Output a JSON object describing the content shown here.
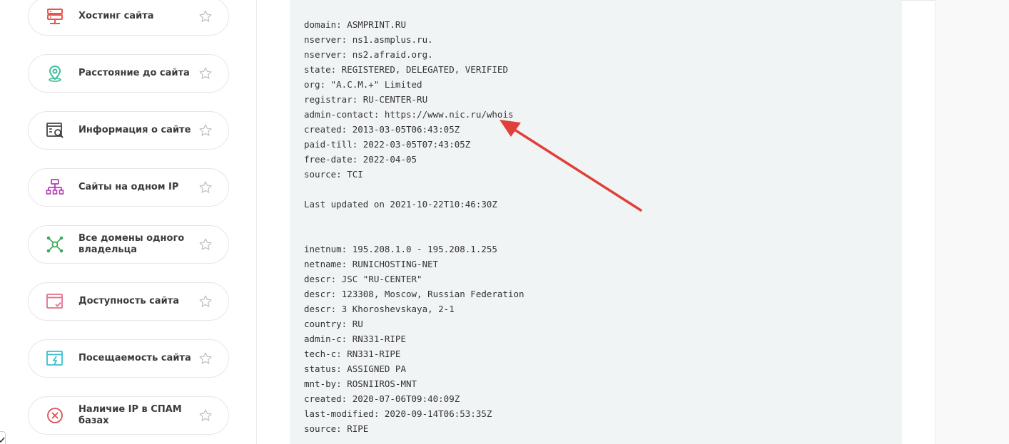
{
  "sidebar": {
    "items": [
      {
        "label": "Хостинг сайта",
        "icon": "server-icon",
        "color": "#e8554e"
      },
      {
        "label": "Расстояние до сайта",
        "icon": "map-pin-icon",
        "color": "#3bbf9c"
      },
      {
        "label": "Информация о сайте",
        "icon": "site-search-icon",
        "color": "#444444"
      },
      {
        "label": "Сайты на одном IP",
        "icon": "network-icon",
        "color": "#b53fb6"
      },
      {
        "label": "Все домены одного владельца",
        "icon": "hub-icon",
        "color": "#3daa5a"
      },
      {
        "label": "Доступность сайта",
        "icon": "window-check-icon",
        "color": "#e86d8c"
      },
      {
        "label": "Посещаемость сайта",
        "icon": "window-bolt-icon",
        "color": "#3cbfcf"
      },
      {
        "label": "Наличие IP в СПАМ базах",
        "icon": "block-icon",
        "color": "#e04f4f"
      }
    ]
  },
  "whois": {
    "lines": [
      "domain: ASMPRINT.RU",
      "nserver: ns1.asmplus.ru.",
      "nserver: ns2.afraid.org.",
      "state: REGISTERED, DELEGATED, VERIFIED",
      "org: \"A.C.M.+\" Limited",
      "registrar: RU-CENTER-RU",
      "admin-contact: https://www.nic.ru/whois",
      "created: 2013-03-05T06:43:05Z",
      "paid-till: 2022-03-05T07:43:05Z",
      "free-date: 2022-04-05",
      "source: TCI",
      "",
      "Last updated on 2021-10-22T10:46:30Z",
      "",
      "",
      "inetnum: 195.208.1.0 - 195.208.1.255",
      "netname: RUNICHOSTING-NET",
      "descr: JSC \"RU-CENTER\"",
      "descr: 123308, Moscow, Russian Federation",
      "descr: 3 Khoroshevskaya, 2-1",
      "country: RU",
      "admin-c: RN331-RIPE",
      "tech-c: RN331-RIPE",
      "status: ASSIGNED PA",
      "mnt-by: ROSNIIROS-MNT",
      "created: 2020-07-06T09:40:09Z",
      "last-modified: 2020-09-14T06:53:35Z",
      "source: RIPE"
    ]
  },
  "colors": {
    "arrow": "#e0403a",
    "panel_bg": "#f1f4f5",
    "star": "#bdbdbd"
  }
}
